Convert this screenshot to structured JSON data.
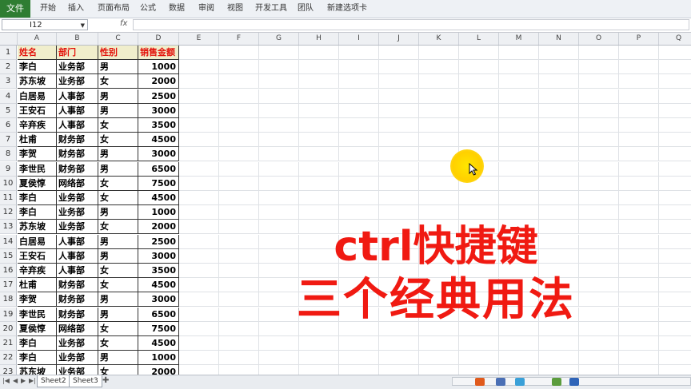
{
  "ribbon": {
    "file_label": "文件",
    "tabs": [
      "开始",
      "插入",
      "页面布局",
      "公式",
      "数据",
      "审阅",
      "视图",
      "开发工具",
      "团队",
      "新建选项卡"
    ]
  },
  "formula_bar": {
    "name_box": "I12",
    "fx": "fx",
    "content": ""
  },
  "columns": [
    "A",
    "B",
    "C",
    "D",
    "E",
    "F",
    "G",
    "H",
    "I",
    "J",
    "K",
    "L",
    "M",
    "N",
    "O",
    "P",
    "Q"
  ],
  "header_row": [
    "姓名",
    "部门",
    "性别",
    "销售金额"
  ],
  "rows": [
    [
      "李白",
      "业务部",
      "男",
      "1000"
    ],
    [
      "苏东坡",
      "业务部",
      "女",
      "2000"
    ],
    [
      "白居易",
      "人事部",
      "男",
      "2500"
    ],
    [
      "王安石",
      "人事部",
      "男",
      "3000"
    ],
    [
      "辛弃疾",
      "人事部",
      "女",
      "3500"
    ],
    [
      "杜甫",
      "财务部",
      "女",
      "4500"
    ],
    [
      "李贺",
      "财务部",
      "男",
      "3000"
    ],
    [
      "李世民",
      "财务部",
      "男",
      "6500"
    ],
    [
      "夏侯惇",
      "网络部",
      "女",
      "7500"
    ],
    [
      "李白",
      "业务部",
      "女",
      "4500"
    ],
    [
      "李白",
      "业务部",
      "男",
      "1000"
    ],
    [
      "苏东坡",
      "业务部",
      "女",
      "2000"
    ],
    [
      "白居易",
      "人事部",
      "男",
      "2500"
    ],
    [
      "王安石",
      "人事部",
      "男",
      "3000"
    ],
    [
      "辛弃疾",
      "人事部",
      "女",
      "3500"
    ],
    [
      "杜甫",
      "财务部",
      "女",
      "4500"
    ],
    [
      "李贺",
      "财务部",
      "男",
      "3000"
    ],
    [
      "李世民",
      "财务部",
      "男",
      "6500"
    ],
    [
      "夏侯惇",
      "网络部",
      "女",
      "7500"
    ],
    [
      "李白",
      "业务部",
      "女",
      "4500"
    ],
    [
      "李白",
      "业务部",
      "男",
      "1000"
    ],
    [
      "苏东坡",
      "业务部",
      "女",
      "2000"
    ]
  ],
  "overlay": {
    "line1": "ctrl快捷键",
    "line2": "三个经典用法"
  },
  "sheets": [
    "Sheet2",
    "Sheet3"
  ],
  "colors": {
    "accent_red": "#f01a12",
    "file_green": "#2f7d32",
    "header_fill": "#f0eecc",
    "cursor_yellow": "#ffe600"
  },
  "icons": {
    "cursor": "cursor-arrow-icon",
    "highlight": "cursor-highlight-icon"
  }
}
